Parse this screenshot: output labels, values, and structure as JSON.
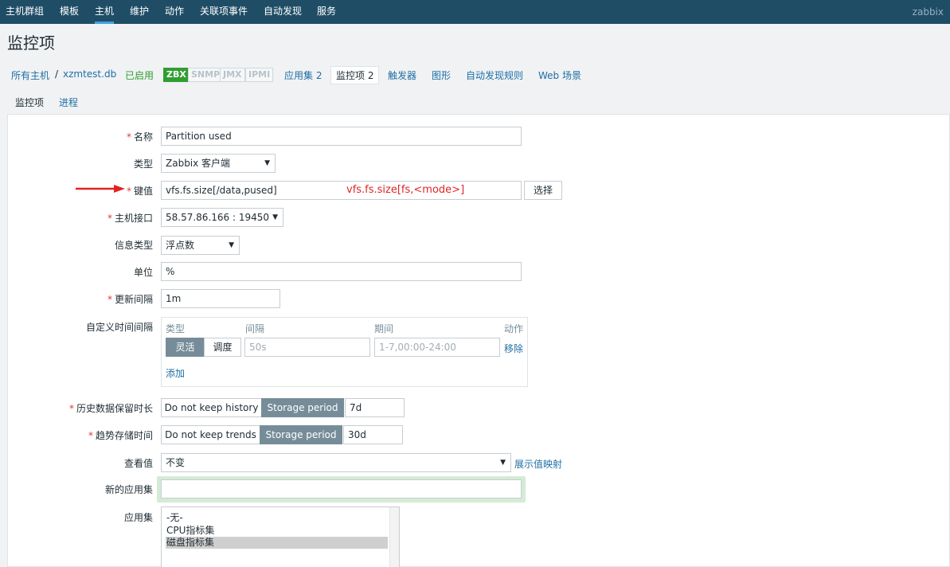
{
  "nav": {
    "items": [
      "主机群组",
      "模板",
      "主机",
      "维护",
      "动作",
      "关联项事件",
      "自动发现",
      "服务"
    ],
    "brand": "zabbix"
  },
  "page_title": "监控项",
  "breadcrumb": {
    "all_hosts": "所有主机",
    "sep": "/",
    "host": "xzmtest.db",
    "status": "已启用",
    "tags": [
      "ZBX",
      "SNMP",
      "JMX",
      "IPMI"
    ],
    "app_sets": "应用集 2",
    "items": "监控项 2",
    "triggers": "触发器",
    "graphs": "图形",
    "discovery": "自动发现规则",
    "web": "Web 场景"
  },
  "tabs": [
    "监控项",
    "进程"
  ],
  "form": {
    "required_mark": "*",
    "name_label": "名称",
    "name_value": "Partition used",
    "type_label": "类型",
    "type_value": "Zabbix 客户端",
    "key_label": "键值",
    "key_value": "vfs.fs.size[/data,pused]",
    "key_hint": "vfs.fs.size[fs,<mode>]",
    "key_select_button": "选择",
    "interface_label": "主机接口",
    "interface_value": "58.57.86.166 : 19450",
    "info_type_label": "信息类型",
    "info_type_value": "浮点数",
    "unit_label": "单位",
    "unit_value": "%",
    "interval_label": "更新间隔",
    "interval_value": "1m",
    "custom_label": "自定义时间间隔",
    "custom": {
      "col_type": "类型",
      "col_interval": "间隔",
      "col_period": "期间",
      "col_action": "动作",
      "flexible": "灵活",
      "scheduling": "调度",
      "interval_placeholder": "50s",
      "period_placeholder": "1-7,00:00-24:00",
      "remove": "移除",
      "add": "添加"
    },
    "history_label": "历史数据保留时长",
    "history_no_keep": "Do not keep history",
    "history_storage": "Storage period",
    "history_value": "7d",
    "trends_label": "趋势存储时间",
    "trends_no_keep": "Do not keep trends",
    "trends_storage": "Storage period",
    "trends_value": "30d",
    "show_value_label": "查看值",
    "show_value_value": "不变",
    "show_value_link": "展示值映射",
    "new_app_label": "新的应用集",
    "new_app_value": "",
    "apps_label": "应用集",
    "apps_options": [
      "-无-",
      "CPU指标集",
      "磁盘指标集"
    ]
  }
}
